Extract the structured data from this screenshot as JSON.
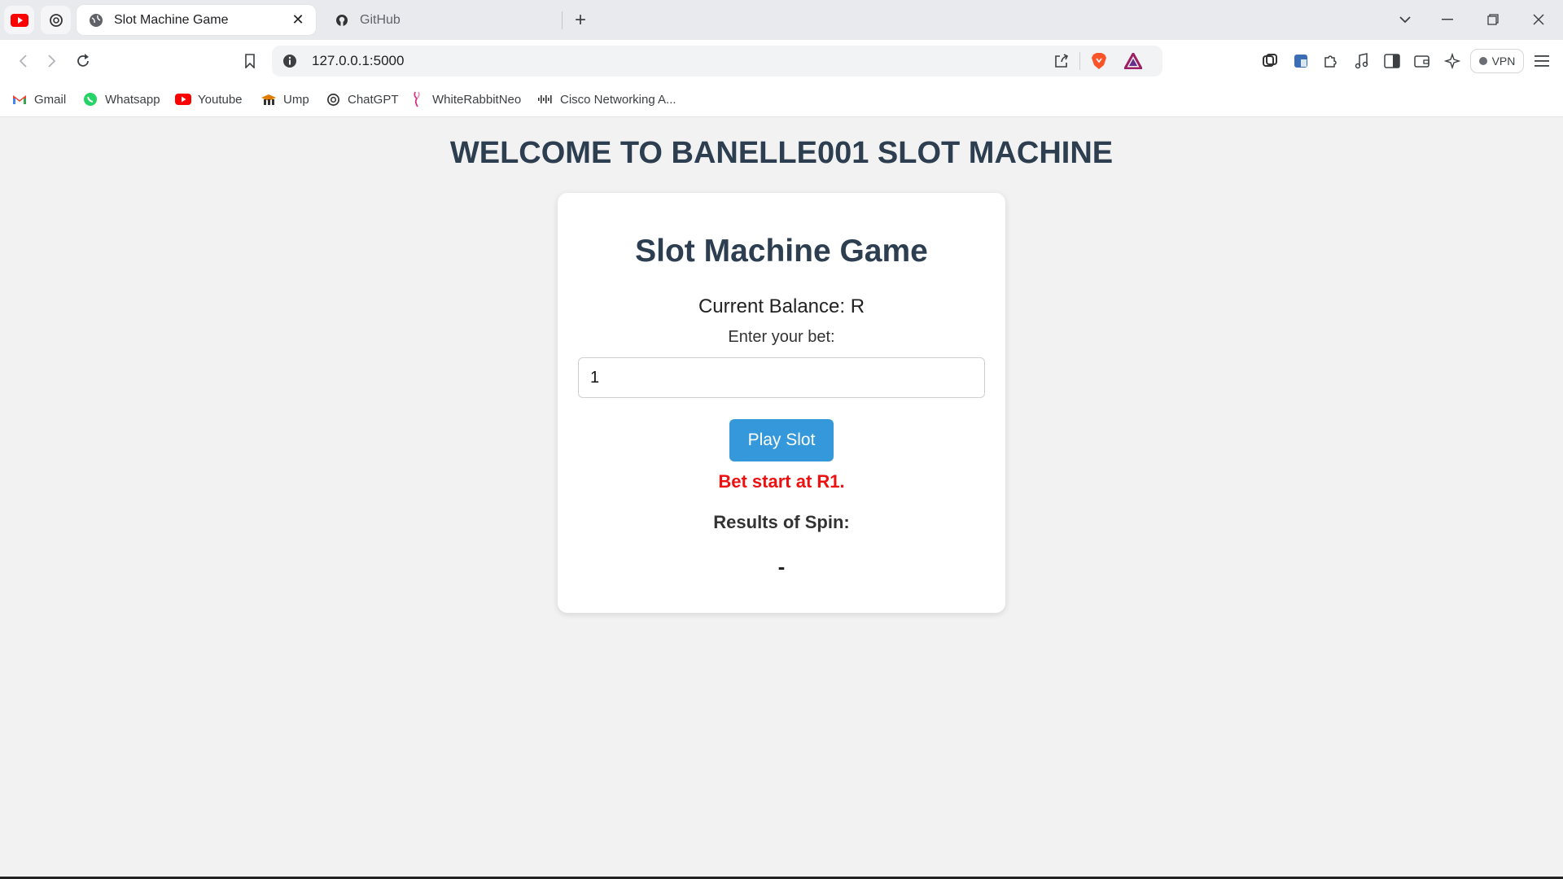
{
  "browser": {
    "tabs": [
      {
        "title": "Slot Machine Game",
        "active": true,
        "icon": "globe-icon"
      },
      {
        "title": "GitHub",
        "active": false,
        "icon": "github-icon"
      }
    ],
    "pinned_tabs": [
      "youtube-icon",
      "openai-icon"
    ],
    "address": "127.0.0.1:5000",
    "vpn_label": "VPN",
    "bookmarks": [
      {
        "label": "Gmail",
        "icon": "gmail-icon"
      },
      {
        "label": "Whatsapp",
        "icon": "whatsapp-icon"
      },
      {
        "label": "Youtube",
        "icon": "youtube-icon"
      },
      {
        "label": "Ump",
        "icon": "ump-icon"
      },
      {
        "label": "ChatGPT",
        "icon": "openai-icon"
      },
      {
        "label": "WhiteRabbitNeo",
        "icon": "rabbit-icon"
      },
      {
        "label": "Cisco Networking A...",
        "icon": "cisco-icon"
      }
    ]
  },
  "page": {
    "heading": "WELCOME TO BANELLE001 SLOT MACHINE",
    "card": {
      "title": "Slot Machine Game",
      "balance": "Current Balance: R",
      "bet_label": "Enter your bet:",
      "bet_value": "1",
      "play_button": "Play Slot",
      "notice": "Bet start at R1.",
      "results_label": "Results of Spin:",
      "results_value": "-"
    }
  },
  "colors": {
    "heading": "#2c3e50",
    "button": "#3498db",
    "notice": "#ee1111",
    "page_bg": "#f2f2f2"
  }
}
